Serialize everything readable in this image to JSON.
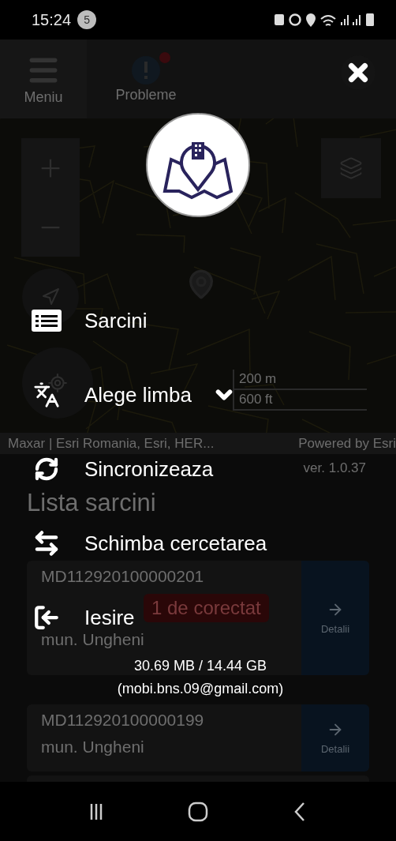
{
  "status_bar": {
    "time": "15:24",
    "notification_count": "5"
  },
  "app": {
    "header": {
      "menu_label": "Meniu",
      "problems_label": "Probleme"
    },
    "map": {
      "scale_metric": "200 m",
      "scale_imperial": "600 ft",
      "attribution": "Maxar | Esri Romania, Esri, HER...",
      "powered_by": "Powered by Esri"
    },
    "version": "ver. 1.0.37",
    "list_title": "Lista sarcini",
    "tasks": [
      {
        "code": "MD112920100000201",
        "address": "mun. Ungheni",
        "badge": "1 de corectat",
        "action": "Detalii"
      },
      {
        "code": "MD112920100000199",
        "address": "mun. Ungheni",
        "action": "Detalii"
      }
    ]
  },
  "menu": {
    "items": [
      {
        "kind": "link",
        "label": "Sarcini"
      },
      {
        "kind": "dropdown",
        "label": "Alege limba",
        "expanded": false
      },
      {
        "kind": "link",
        "label": "Sincronizeaza"
      },
      {
        "kind": "link",
        "label": "Schimba cercetarea"
      },
      {
        "kind": "link",
        "label": "Iesire"
      }
    ],
    "storage": "30.69 MB / 14.44 GB",
    "account": "(mobi.bns.09@gmail.com)"
  }
}
